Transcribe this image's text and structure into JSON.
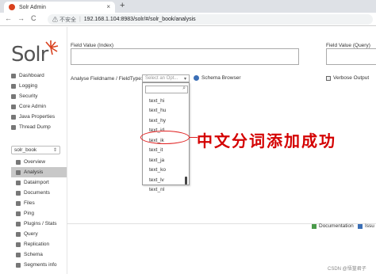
{
  "browser": {
    "tab_title": "Solr Admin",
    "tab_close": "×",
    "new_tab": "+",
    "nav_back": "←",
    "nav_forward": "→",
    "nav_reload": "C",
    "security_warning": "不安全",
    "url": "192.168.1.104:8983/solr/#/solr_book/analysis"
  },
  "logo": {
    "text": "Solr"
  },
  "sidebar": {
    "items": [
      {
        "label": "Dashboard",
        "icon": "dashboard-icon"
      },
      {
        "label": "Logging",
        "icon": "logging-icon"
      },
      {
        "label": "Security",
        "icon": "security-icon"
      },
      {
        "label": "Core Admin",
        "icon": "core-admin-icon"
      },
      {
        "label": "Java Properties",
        "icon": "java-icon"
      },
      {
        "label": "Thread Dump",
        "icon": "thread-icon"
      }
    ],
    "core_selector": "solr_book",
    "core_items": [
      {
        "label": "Overview"
      },
      {
        "label": "Analysis"
      },
      {
        "label": "Dataimport"
      },
      {
        "label": "Documents"
      },
      {
        "label": "Files"
      },
      {
        "label": "Ping"
      },
      {
        "label": "Plugins / Stats"
      },
      {
        "label": "Query"
      },
      {
        "label": "Replication"
      },
      {
        "label": "Schema"
      },
      {
        "label": "Segments info"
      }
    ]
  },
  "analysis": {
    "field_value_index_label": "Field Value (Index)",
    "field_value_query_label": "Field Value (Query)",
    "fieldname_label": "Analyse Fieldname / FieldType:",
    "fieldtype_placeholder": "Select an Opt...",
    "schema_browser_label": "Schema Browser",
    "verbose_output_label": "Verbose Output",
    "dropdown_options": [
      "text_hi",
      "text_hu",
      "text_hy",
      "text_id",
      "text_ik",
      "text_it",
      "text_ja",
      "text_ko",
      "text_lv",
      "text_nl"
    ]
  },
  "annotation": {
    "text": "中文分词添加成功"
  },
  "footer": {
    "documentation": "Documentation",
    "issue_tracker": "Issu"
  },
  "watermark": "CSDN @悟篁君子"
}
